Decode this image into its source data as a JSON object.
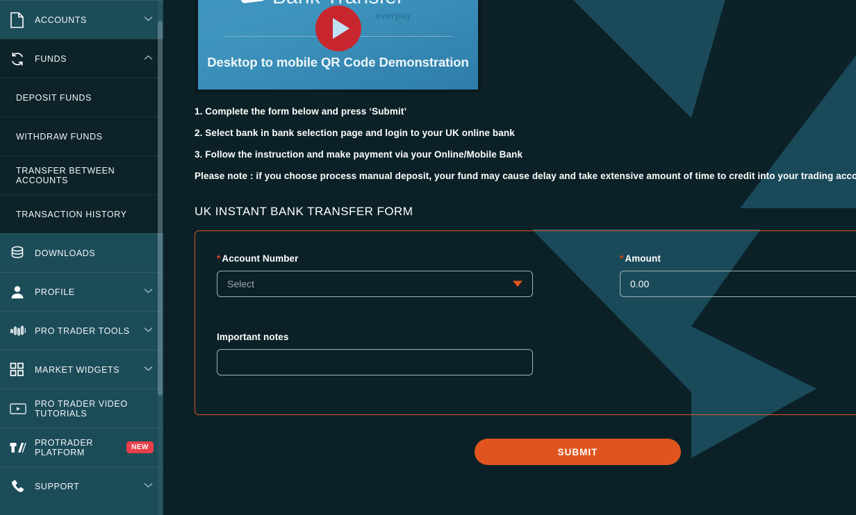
{
  "sidebar": {
    "items": [
      {
        "label": "ACCOUNTS",
        "icon": "document-icon",
        "chevron": "chevron-down-icon",
        "state": "collapsed"
      },
      {
        "label": "FUNDS",
        "icon": "refresh-icon",
        "chevron": "chevron-up-icon",
        "state": "expanded"
      },
      {
        "label": "DOWNLOADS",
        "icon": "database-icon",
        "chevron": "",
        "state": "none"
      },
      {
        "label": "PROFILE",
        "icon": "user-icon",
        "chevron": "chevron-down-icon",
        "state": "collapsed"
      },
      {
        "label": "PRO TRADER TOOLS",
        "icon": "candlestick-icon",
        "chevron": "chevron-down-icon",
        "state": "collapsed"
      },
      {
        "label": "MARKET WIDGETS",
        "icon": "grid-icon",
        "chevron": "chevron-down-icon",
        "state": "collapsed"
      },
      {
        "label": "PRO TRADER VIDEO TUTORIALS",
        "icon": "video-icon",
        "chevron": "",
        "state": "none"
      },
      {
        "label": "PROTRADER PLATFORM",
        "icon": "tradingview-icon",
        "chevron": "",
        "state": "none",
        "badge": "NEW"
      },
      {
        "label": "SUPPORT",
        "icon": "phone-icon",
        "chevron": "chevron-down-icon",
        "state": "collapsed"
      }
    ],
    "funds_subitems": [
      {
        "label": "DEPOSIT FUNDS"
      },
      {
        "label": "WITHDRAW FUNDS"
      },
      {
        "label": "TRANSFER BETWEEN ACCOUNTS"
      },
      {
        "label": "TRANSACTION HISTORY"
      }
    ]
  },
  "video": {
    "title": "Bank Transfer",
    "brand": "everpay",
    "subtitle": "Desktop to mobile QR Code Demonstration",
    "play_icon": "play-icon"
  },
  "instructions": {
    "step1": "1. Complete the form below and press ‘Submit’",
    "step2": "2. Select bank in bank selection page and login to your UK online bank",
    "step3": "3. Follow the instruction and make payment via your Online/Mobile Bank",
    "note": "Please note : if you choose process manual deposit, your fund may cause delay and take extensive amount of time to credit into your trading account"
  },
  "form": {
    "title": "UK INSTANT BANK TRANSFER FORM",
    "required_marker": "*",
    "account_number": {
      "label": "Account Number",
      "placeholder": "Select",
      "value": "",
      "caret_icon": "triangle-down-icon"
    },
    "amount": {
      "label": "Amount",
      "value": "0.00",
      "placeholder": "0.00"
    },
    "important_notes": {
      "label": "Important notes",
      "value": "",
      "placeholder": ""
    },
    "submit_label": "SUBMIT"
  },
  "colors": {
    "accent_orange": "#e0551f",
    "sidebar_bg": "#1d4c59",
    "sidebar_expanded_bg": "#0d2329",
    "content_bg": "#0b2127",
    "deco_teal": "#1a4a5a",
    "badge_red": "#e8404a",
    "play_red": "#c8262e",
    "video_blue": "#3d93bc"
  }
}
